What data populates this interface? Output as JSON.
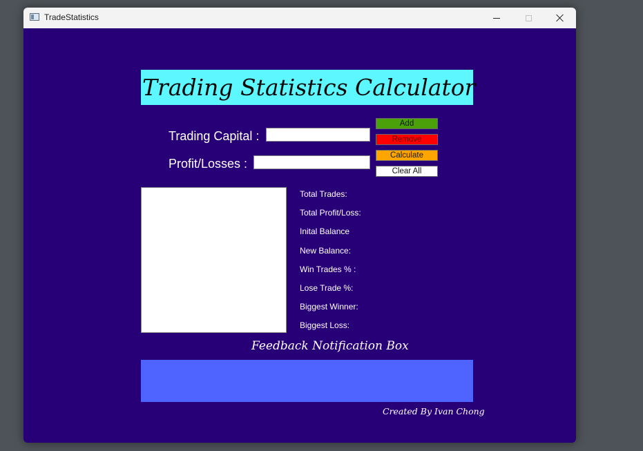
{
  "window": {
    "title": "TradeStatistics"
  },
  "header": {
    "title": "Trading Statistics Calculator"
  },
  "form": {
    "capital_label": "Trading Capital :",
    "capital_value": "",
    "pl_label": "Profit/Losses :",
    "pl_value": ""
  },
  "buttons": {
    "add": "Add",
    "remove": "Remove",
    "calculate": "Calculate",
    "clear_all": "Clear All"
  },
  "stats": [
    "Total Trades:",
    "Total Profit/Loss:",
    "Inital Balance",
    "New Balance:",
    "Win Trades % :",
    "Lose Trade %:",
    "Biggest Winner:",
    "Biggest Loss:"
  ],
  "feedback": {
    "title": "Feedback Notification Box",
    "message": ""
  },
  "footer": {
    "credit": "Created By Ivan Chong"
  },
  "colors": {
    "window_bg": "#270077",
    "banner_bg": "#5cf7ff",
    "add": "#4aa10a",
    "remove": "#ff0000",
    "calculate": "#ffa500",
    "clear": "#ffffff",
    "feedback_bg": "#4e63ff"
  }
}
